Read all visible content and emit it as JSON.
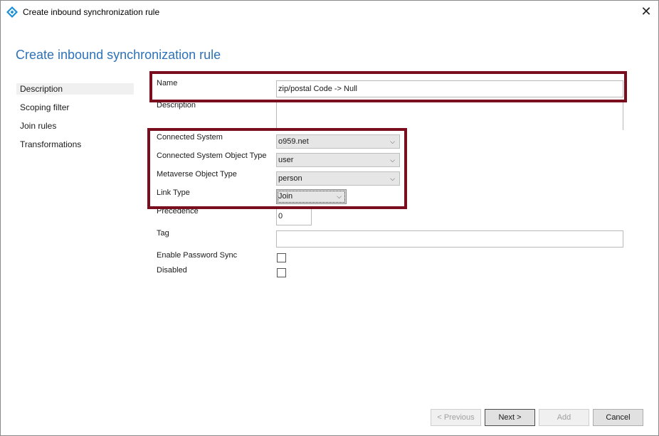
{
  "window": {
    "title": "Create inbound synchronization rule",
    "close_label": "✕"
  },
  "header": {
    "title": "Create inbound synchronization rule"
  },
  "nav": {
    "items": [
      {
        "label": "Description",
        "selected": true
      },
      {
        "label": "Scoping filter"
      },
      {
        "label": "Join rules"
      },
      {
        "label": "Transformations"
      }
    ]
  },
  "form": {
    "name_label": "Name",
    "name_value": "zip/postal Code -> Null",
    "description_label": "Description",
    "description_value": "",
    "connected_system_label": "Connected System",
    "connected_system_value": "o959.net",
    "cs_object_type_label": "Connected System Object Type",
    "cs_object_type_value": "user",
    "mv_object_type_label": "Metaverse Object Type",
    "mv_object_type_value": "person",
    "link_type_label": "Link Type",
    "link_type_value": "Join",
    "precedence_label": "Precedence",
    "precedence_value": "0",
    "tag_label": "Tag",
    "tag_value": "",
    "enable_password_sync_label": "Enable Password Sync",
    "enable_password_sync_checked": false,
    "disabled_label": "Disabled",
    "disabled_checked": false
  },
  "buttons": {
    "previous": "< Previous",
    "next": "Next >",
    "add": "Add",
    "cancel": "Cancel"
  },
  "colors": {
    "header_blue": "#2d72b8",
    "highlight_red": "#7a0d1e"
  },
  "icons": {
    "app": "diamond-sync-icon",
    "dropdown": "chevron-down-icon"
  }
}
